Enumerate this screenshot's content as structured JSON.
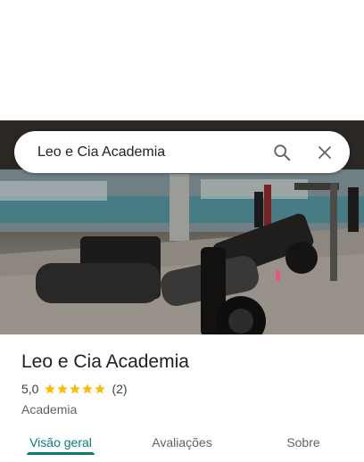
{
  "search": {
    "query": "Leo e Cia Academia"
  },
  "place": {
    "name": "Leo e Cia Academia",
    "rating": "5,0",
    "stars": 5,
    "reviews": "(2)",
    "category": "Academia"
  },
  "tabs": [
    {
      "label": "Visão geral",
      "active": true
    },
    {
      "label": "Avaliações",
      "active": false
    },
    {
      "label": "Sobre",
      "active": false
    }
  ],
  "colors": {
    "accent": "#0b7a7a",
    "star": "#fbbc04"
  },
  "icons": [
    "search-icon",
    "close-icon",
    "star-icon"
  ]
}
